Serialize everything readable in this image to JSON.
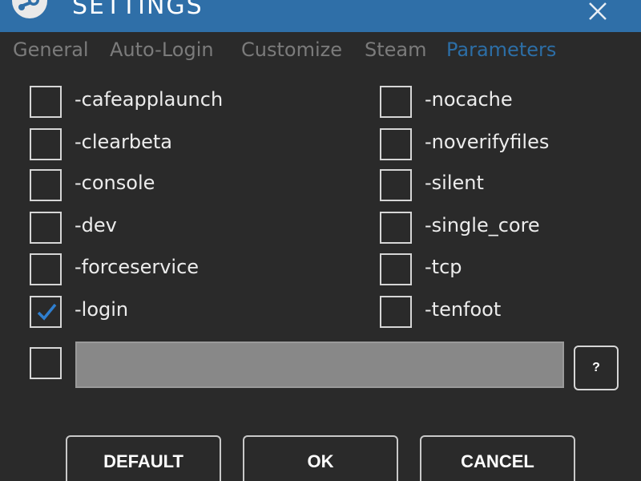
{
  "window": {
    "title": "SETTINGS",
    "icons": {
      "logo": "steam-logo-icon",
      "close": "close-icon"
    }
  },
  "tabs": [
    {
      "label": "General",
      "active": false
    },
    {
      "label": "Auto-Login",
      "active": false
    },
    {
      "label": "Customize",
      "active": false
    },
    {
      "label": "Steam",
      "active": false
    },
    {
      "label": "Parameters",
      "active": true
    }
  ],
  "parameters": {
    "left": [
      {
        "label": "-cafeapplaunch",
        "checked": false
      },
      {
        "label": "-clearbeta",
        "checked": false
      },
      {
        "label": "-console",
        "checked": false
      },
      {
        "label": "-dev",
        "checked": false
      },
      {
        "label": "-forceservice",
        "checked": false
      },
      {
        "label": "-login",
        "checked": true
      }
    ],
    "right": [
      {
        "label": "-nocache",
        "checked": false
      },
      {
        "label": "-noverifyfiles",
        "checked": false
      },
      {
        "label": "-silent",
        "checked": false
      },
      {
        "label": "-single_core",
        "checked": false
      },
      {
        "label": "-tcp",
        "checked": false
      },
      {
        "label": "-tenfoot",
        "checked": false
      }
    ],
    "custom": {
      "checked": false,
      "value": "",
      "placeholder": ""
    },
    "help_label": "?"
  },
  "buttons": {
    "default": "DEFAULT",
    "ok": "OK",
    "cancel": "CANCEL"
  },
  "colors": {
    "titlebar": "#2f6fa8",
    "background": "#2a2a2a",
    "active_tab": "#2c6ea6",
    "inactive_tab": "#7b7b7b",
    "checkmark": "#2f7fd0",
    "input_bg": "#888888"
  }
}
